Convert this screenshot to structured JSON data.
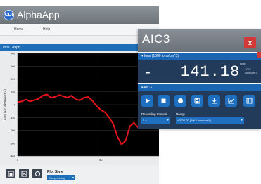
{
  "app": {
    "logo_text": "CDI",
    "title": "AlphaApp",
    "menu": [
      "Home",
      "Help"
    ],
    "graph_title": "Ions Graph",
    "ylabel": "Ions (10^3 ions/cm^3)",
    "yticks": [
      "400",
      "300",
      "200",
      "100",
      "0",
      "-100",
      "-200",
      "-300",
      "-400"
    ],
    "xticks": [
      "0",
      "40"
    ],
    "plot_style_label": "Plot Style",
    "plot_style_value": "Compressing",
    "toolbar_icons": [
      "save-image-icon",
      "export-image-icon",
      "reset-view-icon"
    ]
  },
  "chart_data": {
    "type": "line",
    "ylim": [
      -400,
      400
    ],
    "yticks": [
      400,
      300,
      200,
      100,
      0,
      -100,
      -200,
      -300,
      -400
    ],
    "xticks": [
      0,
      40
    ],
    "xlim": [
      0,
      68
    ],
    "grid": true,
    "series": [
      {
        "color": "#e8141b",
        "x": [
          0,
          2,
          4,
          6,
          8,
          10,
          12,
          14,
          16,
          18,
          20,
          22,
          24,
          26,
          28,
          30,
          32,
          34,
          36,
          38,
          40,
          42,
          44,
          46,
          48,
          50,
          52,
          54,
          56,
          58,
          60,
          62,
          64,
          66,
          68
        ],
        "y": [
          20,
          25,
          40,
          25,
          35,
          45,
          70,
          80,
          55,
          60,
          75,
          65,
          55,
          70,
          40,
          35,
          55,
          60,
          30,
          -10,
          -40,
          -60,
          -100,
          -150,
          -250,
          -310,
          -280,
          -170,
          -140,
          -180,
          -185,
          -160,
          -130,
          -110,
          -75
        ]
      }
    ]
  },
  "aic": {
    "title": "AIC3",
    "close": "x",
    "ions_header": "Ions (1000 ions/cm^3)",
    "ions_sign": "-",
    "ions_value": "141.18",
    "ions_peak": "peak",
    "ions_unit": "10^3 ions/cm^3",
    "section_header": "AIC3",
    "controls": [
      "play-icon",
      "stop-icon",
      "record-icon",
      "save-icon",
      "download-icon",
      "chart-icon",
      "columns-icon"
    ],
    "recording_interval_label": "Recording Interval",
    "recording_interval_value": "5 s",
    "range_label": "Range",
    "range_value": "±2000.00 (10^3 ions/cm^3)"
  }
}
